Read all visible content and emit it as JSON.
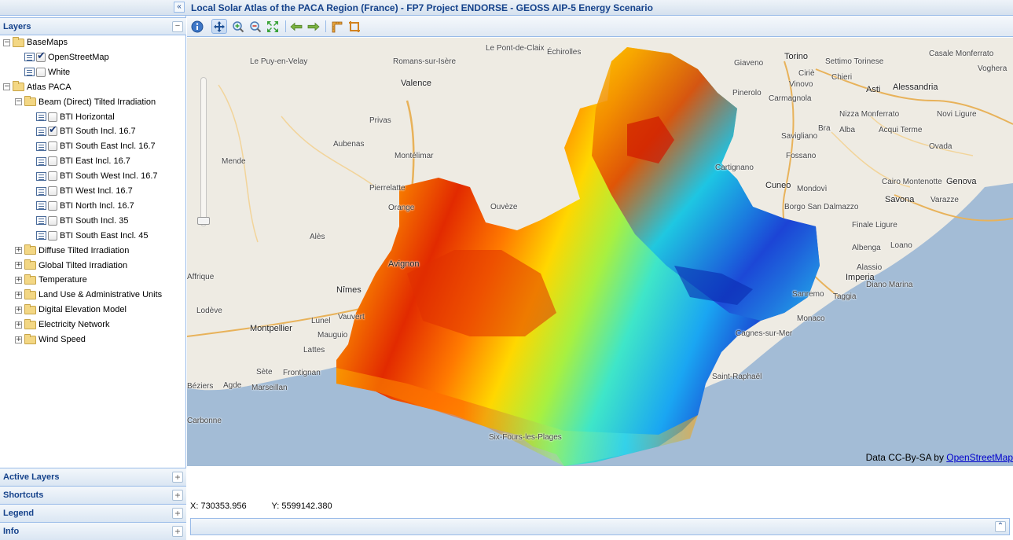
{
  "app": {
    "title": "Local Solar Atlas of the PACA Region (France) - FP7 Project ENDORSE - GEOSS AIP-5 Energy Scenario",
    "collapse_glyph": "«"
  },
  "layers_panel": {
    "title": "Layers",
    "tool_glyph": "−",
    "tree": [
      {
        "label": "BaseMaps",
        "type": "folder",
        "expanded": true
      },
      {
        "label": "OpenStreetMap",
        "type": "layer",
        "checked": true
      },
      {
        "label": "White",
        "type": "layer",
        "checked": false
      },
      {
        "label": "Atlas PACA",
        "type": "folder",
        "expanded": true
      },
      {
        "label": "Beam (Direct) Tilted Irradiation",
        "type": "folder",
        "expanded": true
      },
      {
        "label": "BTI Horizontal",
        "type": "layer",
        "checked": false
      },
      {
        "label": "BTI South Incl. 16.7",
        "type": "layer",
        "checked": true
      },
      {
        "label": "BTI South East Incl. 16.7",
        "type": "layer",
        "checked": false
      },
      {
        "label": "BTI East Incl. 16.7",
        "type": "layer",
        "checked": false
      },
      {
        "label": "BTI South West Incl. 16.7",
        "type": "layer",
        "checked": false
      },
      {
        "label": "BTI West Incl. 16.7",
        "type": "layer",
        "checked": false
      },
      {
        "label": "BTI North Incl. 16.7",
        "type": "layer",
        "checked": false
      },
      {
        "label": "BTI South Incl. 35",
        "type": "layer",
        "checked": false
      },
      {
        "label": "BTI South East Incl. 45",
        "type": "layer",
        "checked": false
      },
      {
        "label": "Diffuse Tilted Irradiation",
        "type": "folder",
        "expanded": false
      },
      {
        "label": "Global Tilted Irradiation",
        "type": "folder",
        "expanded": false
      },
      {
        "label": "Temperature",
        "type": "folder",
        "expanded": false
      },
      {
        "label": "Land Use & Administrative Units",
        "type": "folder",
        "expanded": false
      },
      {
        "label": "Digital Elevation Model",
        "type": "folder",
        "expanded": false
      },
      {
        "label": "Electricity Network",
        "type": "folder",
        "expanded": false
      },
      {
        "label": "Wind Speed",
        "type": "folder",
        "expanded": false
      }
    ]
  },
  "accordion": [
    {
      "label": "Active Layers",
      "tool": "+"
    },
    {
      "label": "Shortcuts",
      "tool": "+"
    },
    {
      "label": "Legend",
      "tool": "+"
    },
    {
      "label": "Info",
      "tool": "+"
    }
  ],
  "toolbar": {
    "buttons": [
      "info-icon",
      "pan-icon",
      "zoom-in-icon",
      "zoom-out-icon",
      "zoom-extent-icon",
      "back-icon",
      "forward-icon",
      "measure-length-icon",
      "measure-area-icon"
    ]
  },
  "map": {
    "attribution_prefix": "Data CC-By-SA by ",
    "attribution_link": "OpenStreetMap",
    "places": [
      "Le Puy-en-Velay",
      "Romans-sur-Isère",
      "Le Pont-de-Claix",
      "Échirolles",
      "Valence",
      "Privas",
      "Aubenas",
      "Montélimar",
      "Mende",
      "Pierrelatte",
      "Orange",
      "Alès",
      "Avignon",
      "Nîmes",
      "Montpellier",
      "Lunel",
      "Lattes",
      "Sète",
      "Frontignan",
      "Agde",
      "Marseillan",
      "Lodève",
      "Torino",
      "Settimo Torinese",
      "Chieri",
      "Pinerolo",
      "Carmagnola",
      "Asti",
      "Alessandria",
      "Savigliano",
      "Fossano",
      "Cuneo",
      "Mondovì",
      "Borgo San Dalmazzo",
      "Savona",
      "Genova",
      "Imperia",
      "Diano Marina",
      "Sanremo",
      "Taggia",
      "Albenga",
      "Loano",
      "Alassio",
      "Finale Ligure",
      "Cairo Montenotte",
      "Varazze",
      "Acqui Terme",
      "Ovada",
      "Nizza Monferrato",
      "Novi Ligure",
      "Bra",
      "Alba",
      "Cartignano",
      "Giaveno",
      "Ciriè",
      "Casale Monferrato",
      "Voghera",
      "Six-Fours-les-Plages",
      "Saint-Raphaël",
      "Monaco",
      "Cagnes-sur-Mer",
      "Mauguio",
      "Vauvert",
      "Ouvèze",
      "Affrique",
      "Carbonne",
      "Vinovo",
      "Béziers"
    ]
  },
  "status": {
    "x_label": "X: 730353.956",
    "y_label": "Y: 5599142.380",
    "expand_glyph": "⌃"
  },
  "colors": {
    "header_text": "#15428b",
    "border": "#99bbe8",
    "sea": "#a3bcd6",
    "land": "#eeebe3"
  }
}
